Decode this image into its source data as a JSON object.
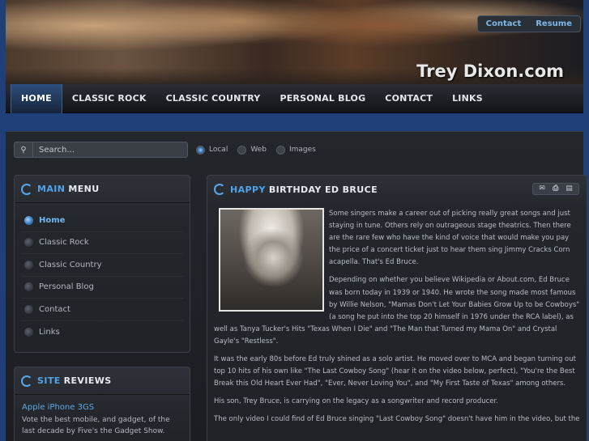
{
  "header": {
    "site_title": "Trey Dixon.com",
    "top_links": [
      "Contact",
      "Resume"
    ]
  },
  "nav": {
    "items": [
      "HOME",
      "CLASSIC ROCK",
      "CLASSIC COUNTRY",
      "PERSONAL BLOG",
      "CONTACT",
      "LINKS"
    ],
    "active": "HOME"
  },
  "search": {
    "placeholder": "Search...",
    "options": [
      "Local",
      "Web",
      "Images"
    ],
    "selected": "Local"
  },
  "main_menu": {
    "title_accent": "MAIN",
    "title_rest": "MENU",
    "items": [
      "Home",
      "Classic Rock",
      "Classic Country",
      "Personal Blog",
      "Contact",
      "Links"
    ],
    "active": "Home"
  },
  "site_reviews": {
    "title_accent": "SITE",
    "title_rest": "REVIEWS",
    "link": "Apple iPhone 3GS",
    "text": "Vote the best mobile, and gadget, of the last decade by Five's the Gadget Show."
  },
  "article": {
    "title_accent": "HAPPY",
    "title_rest": "BIRTHDAY ED BRUCE",
    "tool_icons": [
      "email-icon",
      "print-icon",
      "pdf-icon"
    ],
    "paragraphs": [
      "Some singers make a career out of picking really great songs and just staying in tune. Others rely on outrageous stage theatrics. Then there are the rare few who have the kind of voice that would make you pay the price of a concert ticket just to hear them sing Jimmy Cracks Corn acapella. That's Ed Bruce.",
      "Depending on whether you believe Wikipedia or About.com, Ed Bruce was born today in 1939 or 1940. He wrote the song made most famous by Willie Nelson, \"Mamas Don't Let Your Babies Grow Up to be Cowboys\" (a song he put into the top 20 himself in 1976 under the RCA label), as well as Tanya Tucker's Hits \"Texas When I Die\" and \"The Man that Turned my Mama On\" and Crystal Gayle's \"Restless\".",
      "It was the early 80s before Ed truly shined as a solo artist. He moved over to MCA and began turning out top 10 hits of his own like \"The Last Cowboy Song\" (hear it on the video below, perfect), \"You're the Best Break this Old Heart Ever Had\", \"Ever, Never Loving You\", and \"My First Taste of Texas\" among others.",
      "His son, Trey Bruce, is carrying on the legacy as a songwriter and record producer.",
      "The only video I could find of Ed Bruce singing \"Last Cowboy Song\" doesn't have him in the video, but the"
    ]
  }
}
